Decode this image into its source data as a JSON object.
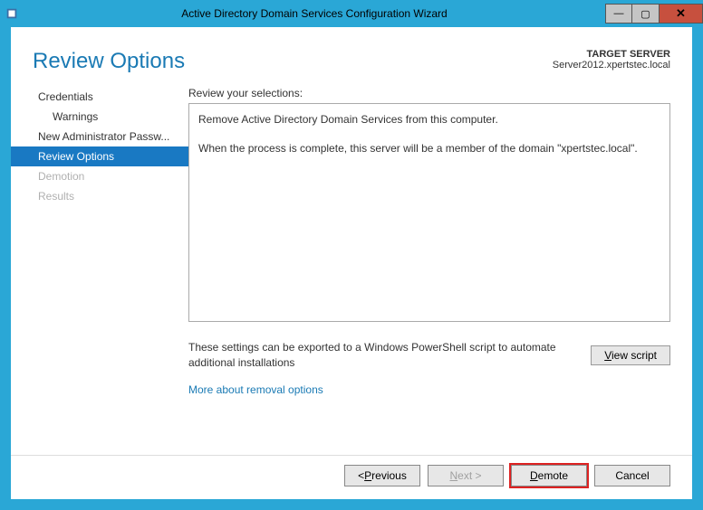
{
  "window": {
    "title": "Active Directory Domain Services Configuration Wizard"
  },
  "header": {
    "page_title": "Review Options",
    "target_label": "TARGET SERVER",
    "target_value": "Server2012.xpertstec.local"
  },
  "sidebar": {
    "items": [
      {
        "label": "Credentials",
        "indent": false,
        "active": false,
        "disabled": false
      },
      {
        "label": "Warnings",
        "indent": true,
        "active": false,
        "disabled": false
      },
      {
        "label": "New Administrator Passw...",
        "indent": false,
        "active": false,
        "disabled": false
      },
      {
        "label": "Review Options",
        "indent": false,
        "active": true,
        "disabled": false
      },
      {
        "label": "Demotion",
        "indent": false,
        "active": false,
        "disabled": true
      },
      {
        "label": "Results",
        "indent": false,
        "active": false,
        "disabled": true
      }
    ]
  },
  "main": {
    "review_label": "Review your selections:",
    "review_lines": {
      "line1": "Remove Active Directory Domain Services from this computer.",
      "line2": "When the process is complete, this server will be a member of the domain \"xpertstec.local\"."
    },
    "export_text": "These settings can be exported to a Windows PowerShell script to automate additional installations",
    "view_script_label": "View script",
    "more_link": "More about removal options"
  },
  "footer": {
    "previous": "< Previous",
    "next": "Next >",
    "demote": "Demote",
    "cancel": "Cancel"
  }
}
